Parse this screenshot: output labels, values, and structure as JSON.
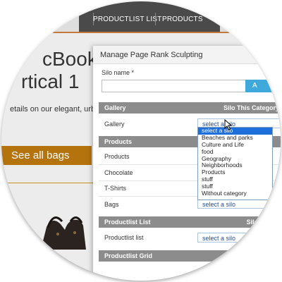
{
  "site": {
    "nav": {
      "item1": "PRODUCTLIST LIST",
      "item2": "PRODUCTS"
    },
    "book_title_line1": "cBook",
    "book_title_line2": "rtical 1",
    "details_text": "etails on our elegant, urb",
    "see_all_button": "See all bags"
  },
  "modal": {
    "title": "Manage Page Rank Sculpting",
    "silo_name_label": "Silo name *",
    "silo_name_value": "",
    "add_button": "A",
    "sections": {
      "gallery": {
        "header": "Gallery",
        "header_right": "Silo This Category",
        "rows": {
          "gallery": "Gallery"
        }
      },
      "products": {
        "header": "Products",
        "rows": {
          "products": "Products",
          "chocolate": "Chocolate",
          "tshirts": "T-Shirts",
          "bags": "Bags"
        }
      },
      "productlist_list": {
        "header": "Productlist List",
        "header_right": "Silo This C",
        "rows": {
          "productlist_list": "Productlist list"
        }
      },
      "productlist_grid": {
        "header": "Productlist Grid"
      }
    },
    "select_placeholder": "select a silo",
    "dropdown_options": [
      "select a silo",
      "Beaches and parks",
      "Culture and Life",
      "food",
      "Geography",
      "Neighborhoods",
      "Products",
      "stuff",
      "stuff",
      "Without category"
    ]
  },
  "colors": {
    "accent_orange": "#b4730c",
    "select_blue": "#1e6fd9",
    "button_blue": "#3fa9dc",
    "section_gray": "#8c8c8c"
  }
}
